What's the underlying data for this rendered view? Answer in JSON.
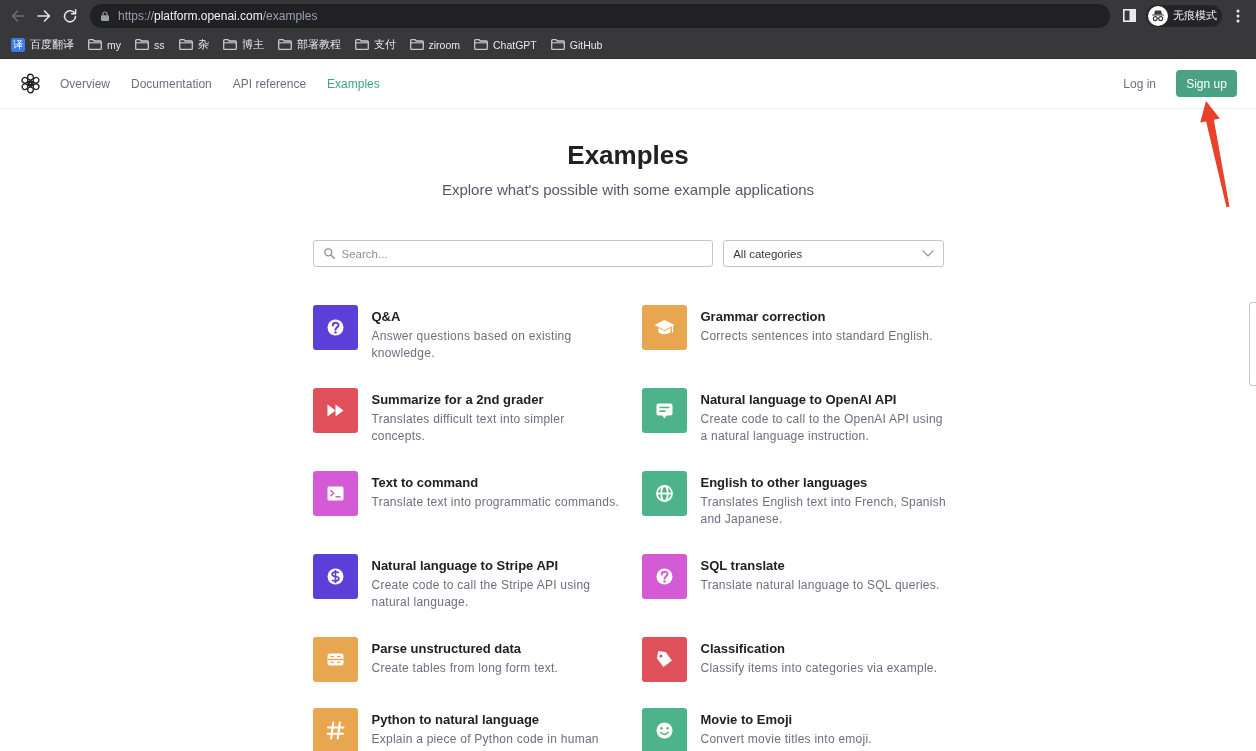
{
  "browser": {
    "nav_buttons": [
      {
        "kind": "back",
        "disabled": true
      },
      {
        "kind": "forward",
        "disabled": false
      },
      {
        "kind": "reload",
        "disabled": false
      }
    ],
    "url": {
      "scheme": "https://",
      "host": "platform.openai.com",
      "path": "/examples"
    },
    "profile": {
      "label": "无痕模式"
    }
  },
  "bookmarks": [
    {
      "kind": "site",
      "favicon_text": "译",
      "label": "百度翻译"
    },
    {
      "kind": "folder",
      "label": "my"
    },
    {
      "kind": "folder",
      "label": "ss"
    },
    {
      "kind": "folder",
      "label": "杂"
    },
    {
      "kind": "folder",
      "label": "博主"
    },
    {
      "kind": "folder",
      "label": "部署教程"
    },
    {
      "kind": "folder",
      "label": "支付"
    },
    {
      "kind": "folder",
      "label": "ziroom"
    },
    {
      "kind": "folder",
      "label": "ChatGPT"
    },
    {
      "kind": "folder",
      "label": "GitHub"
    }
  ],
  "site_nav": {
    "links": [
      {
        "label": "Overview",
        "selected": false
      },
      {
        "label": "Documentation",
        "selected": false
      },
      {
        "label": "API reference",
        "selected": false
      },
      {
        "label": "Examples",
        "selected": true
      }
    ],
    "login": "Log in",
    "signup": "Sign up"
  },
  "header": {
    "title": "Examples",
    "subtitle": "Explore what's possible with some example applications"
  },
  "filters": {
    "search_placeholder": "Search...",
    "category": "All categories"
  },
  "examples": [
    {
      "kind": "question",
      "color": "#5b3fd8",
      "title": "Q&A",
      "description": "Answer questions based on existing knowledge."
    },
    {
      "kind": "mortarboard",
      "color": "#e9a650",
      "title": "Grammar correction",
      "description": "Corrects sentences into standard English."
    },
    {
      "kind": "fast-forward",
      "color": "#e0505a",
      "title": "Summarize for a 2nd grader",
      "description": "Translates difficult text into simpler concepts."
    },
    {
      "kind": "chat",
      "color": "#4db38b",
      "title": "Natural language to OpenAI API",
      "description": "Create code to call to the OpenAI API using a natural language instruction."
    },
    {
      "kind": "terminal",
      "color": "#d55ad6",
      "title": "Text to command",
      "description": "Translate text into programmatic commands."
    },
    {
      "kind": "globe",
      "color": "#4db38b",
      "title": "English to other languages",
      "description": "Translates English text into French, Spanish and Japanese."
    },
    {
      "kind": "dollar",
      "color": "#5b3fd8",
      "title": "Natural language to Stripe API",
      "description": "Create code to call the Stripe API using natural language."
    },
    {
      "kind": "question",
      "color": "#d55ad6",
      "title": "SQL translate",
      "description": "Translate natural language to SQL queries."
    },
    {
      "kind": "table",
      "color": "#e9a650",
      "title": "Parse unstructured data",
      "description": "Create tables from long form text."
    },
    {
      "kind": "tag",
      "color": "#e0505a",
      "title": "Classification",
      "description": "Classify items into categories via example."
    },
    {
      "kind": "hash",
      "color": "#e9a650",
      "title": "Python to natural language",
      "description": "Explain a piece of Python code in human"
    },
    {
      "kind": "smiley",
      "color": "#4db38b",
      "title": "Movie to Emoji",
      "description": "Convert movie titles into emoji."
    }
  ]
}
